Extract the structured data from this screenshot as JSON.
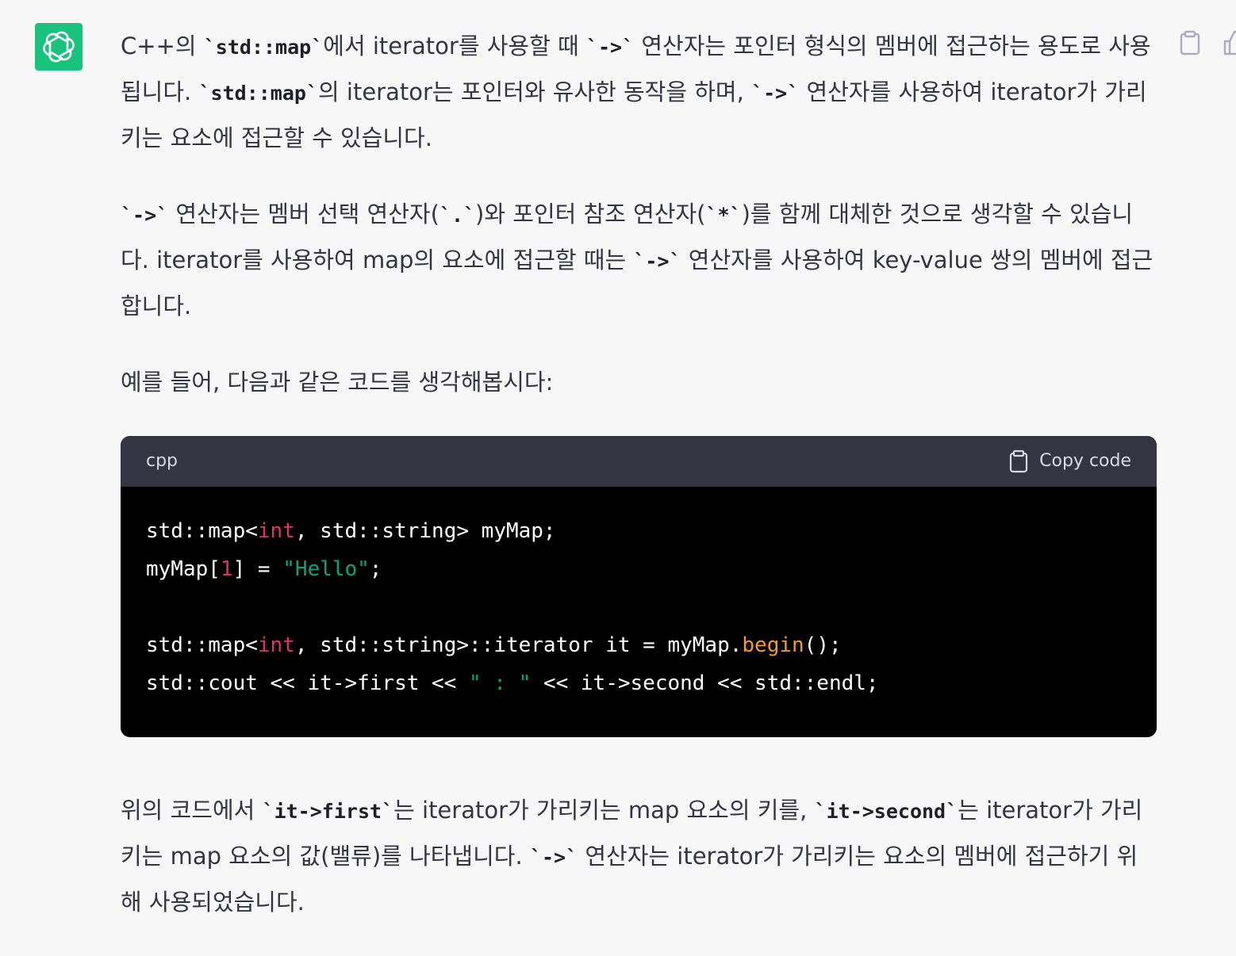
{
  "avatar": {
    "icon": "openai-logo-icon",
    "color": "#19c37d"
  },
  "actions": {
    "copy_icon": "clipboard-icon",
    "thumbs_icon": "thumbs-up-icon"
  },
  "message": {
    "p1": {
      "t1": "C++의 ",
      "c1": "`std::map`",
      "t2": "에서 iterator를 사용할 때 ",
      "c2": "`->`",
      "t3": " 연산자는 포인터 형식의 멤버에 접근하는 용도로 사용됩니다. ",
      "c3": "`std::map`",
      "t4": "의 iterator는 포인터와 유사한 동작을 하며, ",
      "c4": "`->`",
      "t5": " 연산자를 사용하여 iterator가 가리키는 요소에 접근할 수 있습니다."
    },
    "p2": {
      "c1": "`->`",
      "t1": " 연산자는 멤버 선택 연산자(",
      "c2": "`.`",
      "t2": ")와 포인터 참조 연산자(",
      "c3": "`*`",
      "t3": ")를 함께 대체한 것으로 생각할 수 있습니다. iterator를 사용하여 map의 요소에 접근할 때는 ",
      "c4": "`->`",
      "t4": " 연산자를 사용하여 key-value 쌍의 멤버에 접근합니다."
    },
    "p3": "예를 들어, 다음과 같은 코드를 생각해봅시다:",
    "code": {
      "language": "cpp",
      "copy_label": "Copy code",
      "line1": {
        "a": "std::map<",
        "kw": "int",
        "b": ", std::string> myMap;"
      },
      "line2": {
        "a": "myMap[",
        "num": "1",
        "b": "] = ",
        "str": "\"Hello\"",
        "c": ";"
      },
      "line4": {
        "a": "std::map<",
        "kw": "int",
        "b": ", std::string>::iterator it = myMap.",
        "fn": "begin",
        "c": "();"
      },
      "line5": {
        "a": "std::cout << it->first << ",
        "str": "\" : \"",
        "b": " << it->second << std::endl;"
      }
    },
    "p4": {
      "t1": "위의 코드에서 ",
      "c1": "`it->first`",
      "t2": "는 iterator가 가리키는 map 요소의 키를, ",
      "c2": "`it->second`",
      "t3": "는 iterator가 가리키는 map 요소의 값(밸류)를 나타냅니다. ",
      "c3": "`->`",
      "t4": " 연산자는 iterator가 가리키는 요소의 멤버에 접근하기 위해 사용되었습니다."
    }
  },
  "colors": {
    "background": "#f7f7f8",
    "text": "#343541",
    "code_bg": "#000000",
    "code_header": "#343541",
    "keyword": "#e9297a",
    "string": "#00a67d",
    "function": "#f29a2e"
  }
}
